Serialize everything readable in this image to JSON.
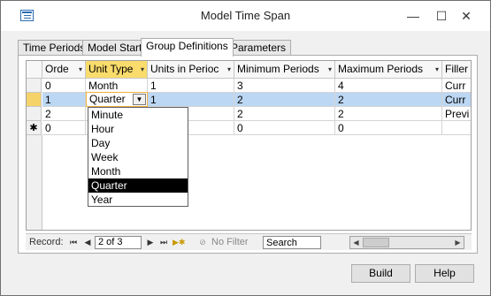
{
  "window": {
    "title": "Model Time Span",
    "minimize_icon": "minimize-icon",
    "maximize_icon": "maximize-icon",
    "close_icon": "close-icon"
  },
  "tabs": [
    {
      "label": "Time Periods",
      "active": false
    },
    {
      "label": "Model Start",
      "active": false
    },
    {
      "label": "Group Definitions",
      "active": true
    },
    {
      "label": "Parameters",
      "active": false
    }
  ],
  "grid": {
    "columns": [
      "Orde",
      "Unit Type",
      "Units in Perioc",
      "Minimum Periods",
      "Maximum Periods",
      "Filler"
    ],
    "rows": [
      {
        "selector": "",
        "cells": [
          "0",
          "Month",
          "1",
          "3",
          "4",
          "Curr"
        ]
      },
      {
        "selector": "",
        "cells": [
          "1",
          "Quarter",
          "1",
          "2",
          "2",
          "Curr"
        ]
      },
      {
        "selector": "",
        "cells": [
          "2",
          "",
          "2",
          "2",
          "2",
          "Previ"
        ]
      },
      {
        "selector": "✱",
        "cells": [
          "0",
          "",
          "",
          "0",
          "0",
          ""
        ]
      }
    ],
    "dropdown_options": [
      "Minute",
      "Hour",
      "Day",
      "Week",
      "Month",
      "Quarter",
      "Year"
    ],
    "dropdown_selected": "Quarter"
  },
  "navigation": {
    "record_label": "Record:",
    "current": "2 of 3",
    "filter_label": "No Filter",
    "search_placeholder": "Search"
  },
  "buttons": {
    "build": "Build",
    "help": "Help"
  },
  "colors": {
    "header_selected": "#fadc6c",
    "row_selected": "#bcd7f3",
    "edit_border": "#f0b040"
  }
}
